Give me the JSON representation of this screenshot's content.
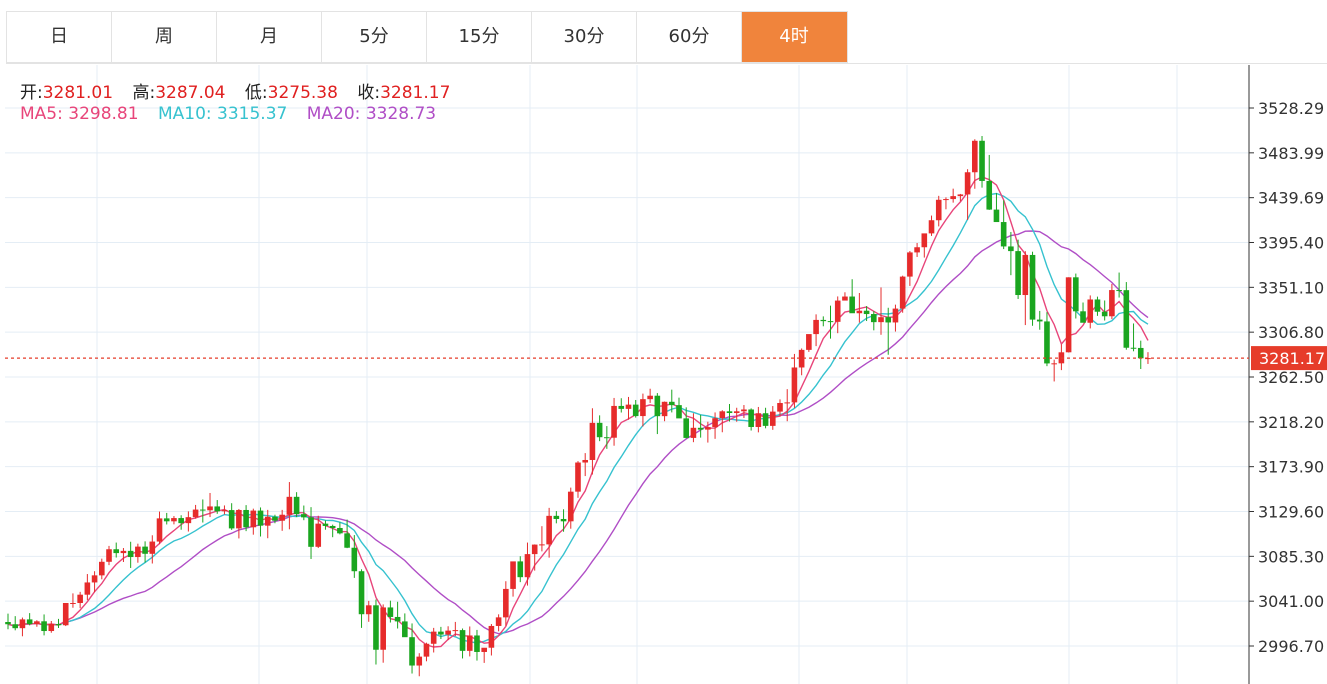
{
  "tabs": [
    {
      "label": "日",
      "active": false
    },
    {
      "label": "周",
      "active": false
    },
    {
      "label": "月",
      "active": false
    },
    {
      "label": "5分",
      "active": false
    },
    {
      "label": "15分",
      "active": false
    },
    {
      "label": "30分",
      "active": false
    },
    {
      "label": "60分",
      "active": false
    },
    {
      "label": "4时",
      "active": true
    }
  ],
  "ohlc": {
    "open_label": "开:",
    "open": "3281.01",
    "high_label": "高:",
    "high": "3287.04",
    "low_label": "低:",
    "low": "3275.38",
    "close_label": "收:",
    "close": "3281.17"
  },
  "ma": {
    "ma5_label": "MA5:",
    "ma5": "3298.81",
    "ma10_label": "MA10:",
    "ma10": "3315.37",
    "ma20_label": "MA20:",
    "ma20": "3328.73"
  },
  "colors": {
    "up": "#e62b2b",
    "down": "#1aa51f",
    "ma5": "#e8457a",
    "ma10": "#36c2cf",
    "ma20": "#b04ec6",
    "grid": "#e4edf5",
    "price_line": "#e63c2a"
  },
  "chart_data": {
    "type": "candlestick",
    "period": "4时",
    "y_axis": {
      "position": "right",
      "ticks": [
        3528.29,
        3483.99,
        3439.69,
        3395.4,
        3351.1,
        3306.8,
        3262.5,
        3218.2,
        3173.9,
        3129.6,
        3085.3,
        3041.0,
        2996.7
      ],
      "tick_labels": [
        "3528.29",
        "3483.99",
        "3439.69",
        "3395.40",
        "3351.10",
        "3306.80",
        "3262.50",
        "3218.20",
        "3173.90",
        "3129.60",
        "3085.30",
        "3041.00",
        "2996.70"
      ]
    },
    "last_price": 3281.17,
    "last_price_label": "3281.17",
    "grid": true,
    "candles": [
      [
        3020.4,
        3028.7,
        3013.3,
        3018.2
      ],
      [
        3018.2,
        3026.2,
        3012.2,
        3014.3
      ],
      [
        3014.3,
        3024.8,
        3006.3,
        3023.0
      ],
      [
        3023.0,
        3029.2,
        3017.1,
        3018.4
      ],
      [
        3018.4,
        3022.2,
        3015.7,
        3021.1
      ],
      [
        3021.1,
        3027.9,
        3007.2,
        3011.5
      ],
      [
        3011.5,
        3021.4,
        3009.8,
        3018.4
      ],
      [
        3018.4,
        3023.5,
        3014.5,
        3017.2
      ],
      [
        3017.2,
        3039.2,
        3016.4,
        3039.2
      ],
      [
        3039.2,
        3048.7,
        3034.5,
        3039.2
      ],
      [
        3039.2,
        3050.2,
        3034.1,
        3047.4
      ],
      [
        3047.4,
        3067.8,
        3042.0,
        3059.5
      ],
      [
        3059.5,
        3070.6,
        3049.9,
        3066.5
      ],
      [
        3066.5,
        3083.0,
        3062.6,
        3079.9
      ],
      [
        3079.9,
        3095.6,
        3076.6,
        3092.3
      ],
      [
        3092.3,
        3098.9,
        3084.1,
        3088.5
      ],
      [
        3088.5,
        3093.5,
        3079.7,
        3090.7
      ],
      [
        3090.7,
        3099.7,
        3073.8,
        3084.6
      ],
      [
        3084.6,
        3097.8,
        3079.0,
        3094.9
      ],
      [
        3094.9,
        3100.1,
        3079.2,
        3087.8
      ],
      [
        3087.8,
        3106.1,
        3078.2,
        3099.9
      ],
      [
        3099.9,
        3129.5,
        3097.3,
        3122.8
      ],
      [
        3122.8,
        3128.2,
        3116.8,
        3119.9
      ],
      [
        3119.9,
        3125.1,
        3116.9,
        3123.1
      ],
      [
        3123.1,
        3125.9,
        3111.6,
        3118.1
      ],
      [
        3118.1,
        3129.7,
        3109.8,
        3124.0
      ],
      [
        3124.0,
        3136.1,
        3122.5,
        3131.5
      ],
      [
        3131.5,
        3141.5,
        3118.7,
        3130.8
      ],
      [
        3130.8,
        3147.9,
        3124.1,
        3134.6
      ],
      [
        3134.6,
        3140.9,
        3127.3,
        3129.8
      ],
      [
        3129.8,
        3135.6,
        3126.7,
        3131.0
      ],
      [
        3131.0,
        3137.8,
        3111.4,
        3112.9
      ],
      [
        3112.9,
        3132.1,
        3103.0,
        3131.1
      ],
      [
        3131.1,
        3135.9,
        3110.2,
        3114.0
      ],
      [
        3114.0,
        3132.4,
        3106.7,
        3130.5
      ],
      [
        3130.5,
        3133.6,
        3104.9,
        3115.6
      ],
      [
        3115.6,
        3131.2,
        3103.2,
        3124.4
      ],
      [
        3124.4,
        3126.4,
        3118.0,
        3120.5
      ],
      [
        3120.5,
        3131.2,
        3110.5,
        3126.4
      ],
      [
        3126.4,
        3158.7,
        3112.0,
        3144.1
      ],
      [
        3144.1,
        3148.7,
        3124.1,
        3127.0
      ],
      [
        3127.0,
        3135.5,
        3121.0,
        3123.8
      ],
      [
        3123.8,
        3133.9,
        3082.7,
        3094.7
      ],
      [
        3094.7,
        3125.4,
        3093.5,
        3117.6
      ],
      [
        3117.6,
        3120.7,
        3111.6,
        3115.3
      ],
      [
        3115.3,
        3116.6,
        3104.2,
        3113.3
      ],
      [
        3113.3,
        3119.0,
        3107.0,
        3108.0
      ],
      [
        3108.0,
        3121.6,
        3093.4,
        3093.8
      ],
      [
        3093.8,
        3106.3,
        3064.0,
        3070.6
      ],
      [
        3070.6,
        3072.5,
        3014.6,
        3028.1
      ],
      [
        3028.1,
        3041.3,
        3020.6,
        3036.9
      ],
      [
        3036.9,
        3042.6,
        2978.4,
        2993.0
      ],
      [
        2993.0,
        3037.8,
        2980.2,
        3034.8
      ],
      [
        3034.8,
        3041.5,
        3019.9,
        3025.4
      ],
      [
        3025.4,
        3040.4,
        3014.0,
        3021.0
      ],
      [
        3021.0,
        3028.9,
        3006.2,
        3005.4
      ],
      [
        3005.4,
        3019.0,
        2969.5,
        2977.4
      ],
      [
        2977.4,
        2989.6,
        2966.8,
        2986.2
      ],
      [
        2986.2,
        3000.0,
        2981.6,
        2998.9
      ],
      [
        2998.9,
        3014.6,
        2990.3,
        3010.9
      ],
      [
        3010.9,
        3015.6,
        3003.6,
        3008.0
      ],
      [
        3008.0,
        3016.2,
        3002.5,
        3011.9
      ],
      [
        3011.9,
        3020.5,
        3006.5,
        3012.4
      ],
      [
        3012.4,
        3014.0,
        2984.4,
        2991.9
      ],
      [
        2991.9,
        3016.0,
        2986.4,
        3007.1
      ],
      [
        3007.1,
        3012.6,
        2982.3,
        2990.8
      ],
      [
        2990.8,
        2994.2,
        2980.0,
        2995.0
      ],
      [
        2995.0,
        3018.4,
        2987.3,
        3016.5
      ],
      [
        3016.5,
        3028.0,
        3011.2,
        3025.0
      ],
      [
        3025.0,
        3060.7,
        3016.6,
        3053.1
      ],
      [
        3053.1,
        3079.1,
        3045.5,
        3080.3
      ],
      [
        3080.3,
        3085.4,
        3059.8,
        3064.7
      ],
      [
        3064.7,
        3098.9,
        3056.4,
        3087.5
      ],
      [
        3087.5,
        3097.1,
        3071.2,
        3096.9
      ],
      [
        3096.9,
        3115.1,
        3090.2,
        3097.1
      ],
      [
        3097.1,
        3133.2,
        3084.0,
        3125.3
      ],
      [
        3125.3,
        3130.0,
        3117.9,
        3122.2
      ],
      [
        3122.2,
        3131.8,
        3109.6,
        3119.9
      ],
      [
        3119.9,
        3153.2,
        3112.6,
        3149.2
      ],
      [
        3149.2,
        3179.4,
        3143.1,
        3178.0
      ],
      [
        3178.0,
        3187.3,
        3164.6,
        3180.5
      ],
      [
        3180.5,
        3231.6,
        3166.1,
        3217.2
      ],
      [
        3217.2,
        3224.6,
        3199.1,
        3203.0
      ],
      [
        3203.0,
        3214.0,
        3191.5,
        3202.5
      ],
      [
        3202.5,
        3241.8,
        3194.6,
        3233.9
      ],
      [
        3233.9,
        3241.5,
        3227.4,
        3231.0
      ],
      [
        3231.0,
        3242.8,
        3220.3,
        3235.2
      ],
      [
        3235.2,
        3239.8,
        3222.4,
        3223.9
      ],
      [
        3223.9,
        3246.1,
        3213.6,
        3240.6
      ],
      [
        3240.6,
        3250.9,
        3236.9,
        3244.0
      ],
      [
        3244.0,
        3246.6,
        3206.1,
        3223.8
      ],
      [
        3223.8,
        3238.3,
        3218.8,
        3238.0
      ],
      [
        3238.0,
        3250.0,
        3227.5,
        3234.7
      ],
      [
        3234.7,
        3242.1,
        3222.6,
        3221.6
      ],
      [
        3221.6,
        3232.5,
        3201.8,
        3202.3
      ],
      [
        3202.3,
        3226.7,
        3198.1,
        3212.3
      ],
      [
        3212.3,
        3225.1,
        3202.6,
        3210.5
      ],
      [
        3210.5,
        3218.3,
        3197.7,
        3213.0
      ],
      [
        3213.0,
        3227.5,
        3201.4,
        3221.8
      ],
      [
        3221.8,
        3229.7,
        3207.9,
        3228.6
      ],
      [
        3228.6,
        3235.8,
        3218.5,
        3226.9
      ],
      [
        3226.9,
        3232.1,
        3218.3,
        3228.6
      ],
      [
        3228.6,
        3234.8,
        3222.0,
        3230.4
      ],
      [
        3230.4,
        3231.5,
        3209.6,
        3213.1
      ],
      [
        3213.1,
        3232.9,
        3207.8,
        3226.7
      ],
      [
        3226.7,
        3232.1,
        3211.8,
        3214.2
      ],
      [
        3214.2,
        3233.8,
        3210.3,
        3228.3
      ],
      [
        3228.3,
        3240.4,
        3224.2,
        3236.8
      ],
      [
        3236.8,
        3250.5,
        3218.8,
        3237.4
      ],
      [
        3237.4,
        3285.3,
        3232.0,
        3271.9
      ],
      [
        3271.9,
        3290.7,
        3264.2,
        3289.3
      ],
      [
        3289.3,
        3303.6,
        3287.3,
        3304.9
      ],
      [
        3304.9,
        3324.4,
        3293.0,
        3318.9
      ],
      [
        3318.9,
        3322.4,
        3312.6,
        3317.7
      ],
      [
        3317.7,
        3333.0,
        3300.4,
        3317.0
      ],
      [
        3317.0,
        3342.1,
        3305.8,
        3338.0
      ],
      [
        3338.0,
        3346.2,
        3338.9,
        3342.0
      ],
      [
        3342.0,
        3359.1,
        3329.6,
        3325.5
      ],
      [
        3325.5,
        3345.5,
        3316.3,
        3328.0
      ],
      [
        3328.0,
        3332.6,
        3317.8,
        3324.7
      ],
      [
        3324.7,
        3327.5,
        3308.6,
        3316.7
      ],
      [
        3316.7,
        3351.0,
        3304.2,
        3321.6
      ],
      [
        3321.6,
        3330.9,
        3284.5,
        3316.4
      ],
      [
        3316.4,
        3334.0,
        3307.4,
        3330.1
      ],
      [
        3330.1,
        3362.6,
        3326.0,
        3361.7
      ],
      [
        3361.7,
        3387.0,
        3352.5,
        3385.6
      ],
      [
        3385.6,
        3394.9,
        3381.1,
        3390.7
      ],
      [
        3390.7,
        3403.9,
        3380.5,
        3404.4
      ],
      [
        3404.4,
        3422.0,
        3401.9,
        3417.4
      ],
      [
        3417.4,
        3441.5,
        3411.3,
        3437.6
      ],
      [
        3437.6,
        3440.0,
        3428.2,
        3438.3
      ],
      [
        3438.3,
        3448.6,
        3434.8,
        3441.2
      ],
      [
        3441.2,
        3443.4,
        3436.1,
        3442.9
      ],
      [
        3442.9,
        3467.8,
        3417.7,
        3464.8
      ],
      [
        3464.8,
        3497.4,
        3448.5,
        3495.9
      ],
      [
        3495.9,
        3500.6,
        3449.6,
        3456.2
      ],
      [
        3456.2,
        3481.9,
        3427.6,
        3427.9
      ],
      [
        3427.9,
        3444.2,
        3416.7,
        3415.6
      ],
      [
        3415.6,
        3437.0,
        3388.9,
        3391.5
      ],
      [
        3391.5,
        3405.8,
        3363.1,
        3386.9
      ],
      [
        3386.9,
        3398.2,
        3339.6,
        3343.5
      ],
      [
        3343.5,
        3386.8,
        3313.8,
        3383.1
      ],
      [
        3383.1,
        3386.3,
        3313.1,
        3319.2
      ],
      [
        3319.2,
        3327.8,
        3309.2,
        3317.4
      ],
      [
        3317.4,
        3326.6,
        3273.2,
        3275.9
      ],
      [
        3275.9,
        3279.6,
        3258.1,
        3276.0
      ],
      [
        3276.0,
        3294.6,
        3269.3,
        3286.9
      ],
      [
        3286.9,
        3361.0,
        3286.7,
        3361.0
      ],
      [
        3361.0,
        3364.7,
        3320.3,
        3327.4
      ],
      [
        3327.4,
        3336.1,
        3316.5,
        3316.1
      ],
      [
        3316.1,
        3343.1,
        3310.5,
        3339.1
      ],
      [
        3339.1,
        3341.9,
        3322.9,
        3327.0
      ],
      [
        3327.0,
        3338.1,
        3318.3,
        3322.5
      ],
      [
        3322.5,
        3354.5,
        3319.7,
        3348.4
      ],
      [
        3348.4,
        3365.7,
        3341.0,
        3348.3
      ],
      [
        3348.3,
        3356.3,
        3289.5,
        3291.4
      ],
      [
        3291.4,
        3315.4,
        3287.9,
        3291.2
      ],
      [
        3291.2,
        3298.4,
        3270.4,
        3281.0
      ],
      [
        3281.01,
        3287.04,
        3275.38,
        3281.17
      ]
    ]
  }
}
